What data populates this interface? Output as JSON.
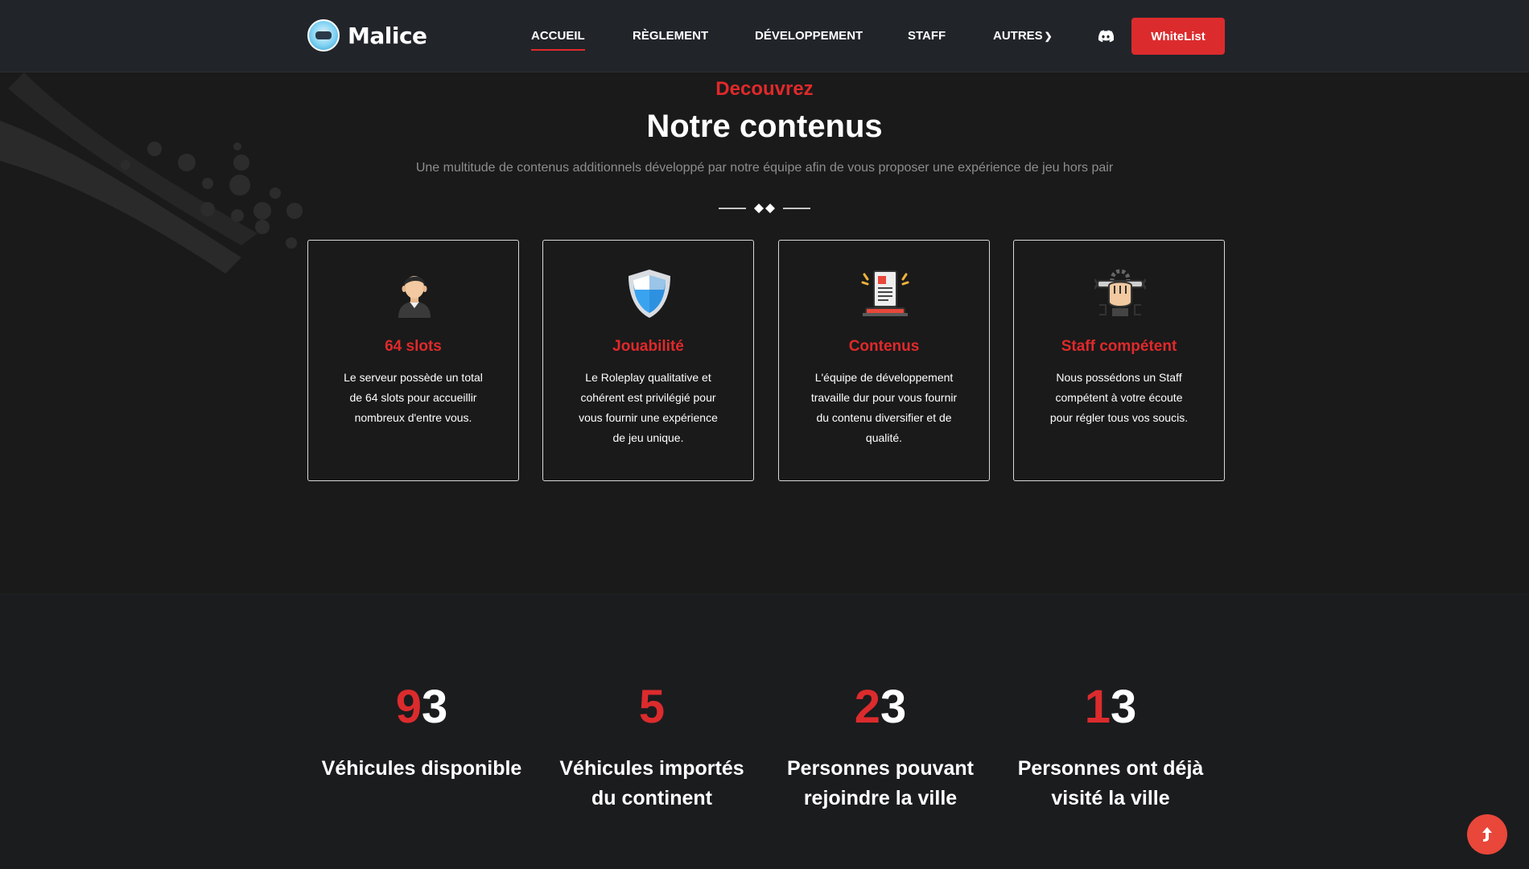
{
  "nav": {
    "brand": "Malice",
    "links": [
      {
        "label": "ACCUEIL",
        "active": true
      },
      {
        "label": "RÈGLEMENT",
        "active": false
      },
      {
        "label": "DÉVELOPPEMENT",
        "active": false
      },
      {
        "label": "STAFF",
        "active": false
      },
      {
        "label": "AUTRES",
        "active": false
      }
    ],
    "autres_chevron_icon": "chevron-right-icon",
    "discord_icon": "discord-icon",
    "whitelist_label": "WhiteList"
  },
  "section": {
    "kicker": "Decouvrez",
    "title": "Notre contenus",
    "subtitle": "Une multitude de contenus additionnels développé par notre équipe afin de vous proposer une expérience de jeu hors pair"
  },
  "cards": [
    {
      "icon": "user-icon",
      "title": "64 slots",
      "text": "Le serveur possède un total de 64 slots pour accueillir nombreux d'entre vous."
    },
    {
      "icon": "shield-icon",
      "title": "Jouabilité",
      "text": "Le Roleplay qualitative et cohérent est privilégié pour vous fournir une expérience de jeu unique."
    },
    {
      "icon": "document-icon",
      "title": "Contenus",
      "text": "L'équipe de développement travaille dur pour vous fournir du contenu diversifier et de qualité."
    },
    {
      "icon": "fist-wrench-icon",
      "title": "Staff compétent",
      "text": "Nous possédons un Staff compétent à votre écoute pour régler tous vos soucis."
    }
  ],
  "stats": [
    {
      "red": "9",
      "white": "3",
      "label": "Véhicules disponible"
    },
    {
      "red": "5",
      "white": "",
      "label": "Véhicules importés du continent"
    },
    {
      "red": "2",
      "white": "3",
      "label": "Personnes pouvant rejoindre la ville"
    },
    {
      "red": "1",
      "white": "3",
      "label": "Personnes ont déjà visité la ville"
    }
  ],
  "scroll_top_icon": "arrow-up-icon",
  "colors": {
    "accent": "#dc2b2d",
    "navbar": "#212529",
    "background": "#1a1a1a"
  }
}
